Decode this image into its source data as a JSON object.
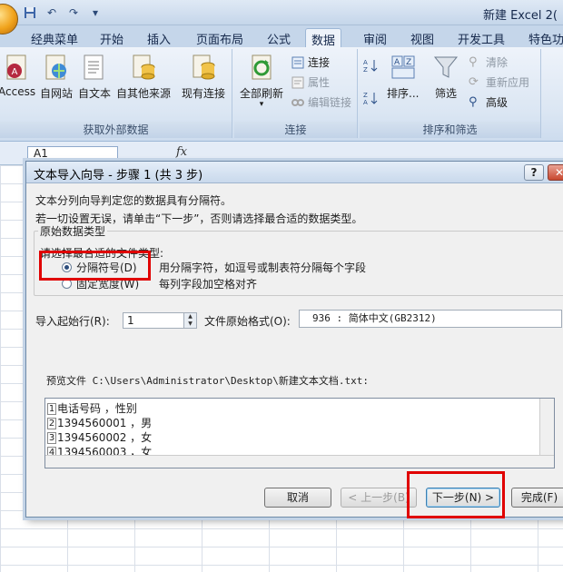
{
  "window": {
    "title": "新建 Excel 2("
  },
  "quick_access": [
    "save-icon",
    "undo-icon",
    "redo-icon",
    "customize-icon"
  ],
  "tabs": [
    {
      "label": "经典菜单"
    },
    {
      "label": "开始"
    },
    {
      "label": "插入"
    },
    {
      "label": "页面布局"
    },
    {
      "label": "公式"
    },
    {
      "label": "数据"
    },
    {
      "label": "审阅"
    },
    {
      "label": "视图"
    },
    {
      "label": "开发工具"
    },
    {
      "label": "特色功"
    }
  ],
  "ribbon": {
    "external": {
      "label": "获取外部数据",
      "buttons": [
        "Access",
        "自网站",
        "自文本",
        "自其他来源",
        "现有连接"
      ]
    },
    "connections": {
      "label": "连接",
      "refresh": "全部刷新",
      "items": [
        "连接",
        "属性",
        "编辑链接"
      ]
    },
    "sort": {
      "label": "排序和筛选",
      "sort": "排序...",
      "filter": "筛选",
      "items": [
        "清除",
        "重新应用",
        "高级"
      ]
    }
  },
  "formula_bar": {
    "cell": "A1",
    "fx": "fx"
  },
  "dialog": {
    "title": "文本导入向导 - 步骤 1 (共 3 步)",
    "intro1": "文本分列向导判定您的数据具有分隔符。",
    "intro2": "若一切设置无误，请单击“下一步”，否则请选择最合适的数据类型。",
    "fieldset_legend": "原始数据类型",
    "choose_label": "请选择最合适的文件类型:",
    "option1": {
      "label": "分隔符号(D)",
      "desc": "用分隔字符，如逗号或制表符分隔每个字段"
    },
    "option2": {
      "label": "固定宽度(W)",
      "desc": "每列字段加空格对齐"
    },
    "start_row_label": "导入起始行(R):",
    "start_row_value": "1",
    "file_origin_label": "文件原始格式(O):",
    "file_origin_value": "936 : 简体中文(GB2312)",
    "preview_label": "预览文件 C:\\Users\\Administrator\\Desktop\\新建文本文档.txt:",
    "preview_rows": [
      {
        "num": "1",
        "text": "电话号码  ，性别"
      },
      {
        "num": "2",
        "text": "1394560001 ，男"
      },
      {
        "num": "3",
        "text": "1394560002 ，女"
      },
      {
        "num": "4",
        "text": "1394560003 ，女"
      }
    ],
    "buttons": {
      "cancel": "取消",
      "back": "< 上一步(B)",
      "next": "下一步(N) >",
      "finish": "完成(F)"
    }
  }
}
